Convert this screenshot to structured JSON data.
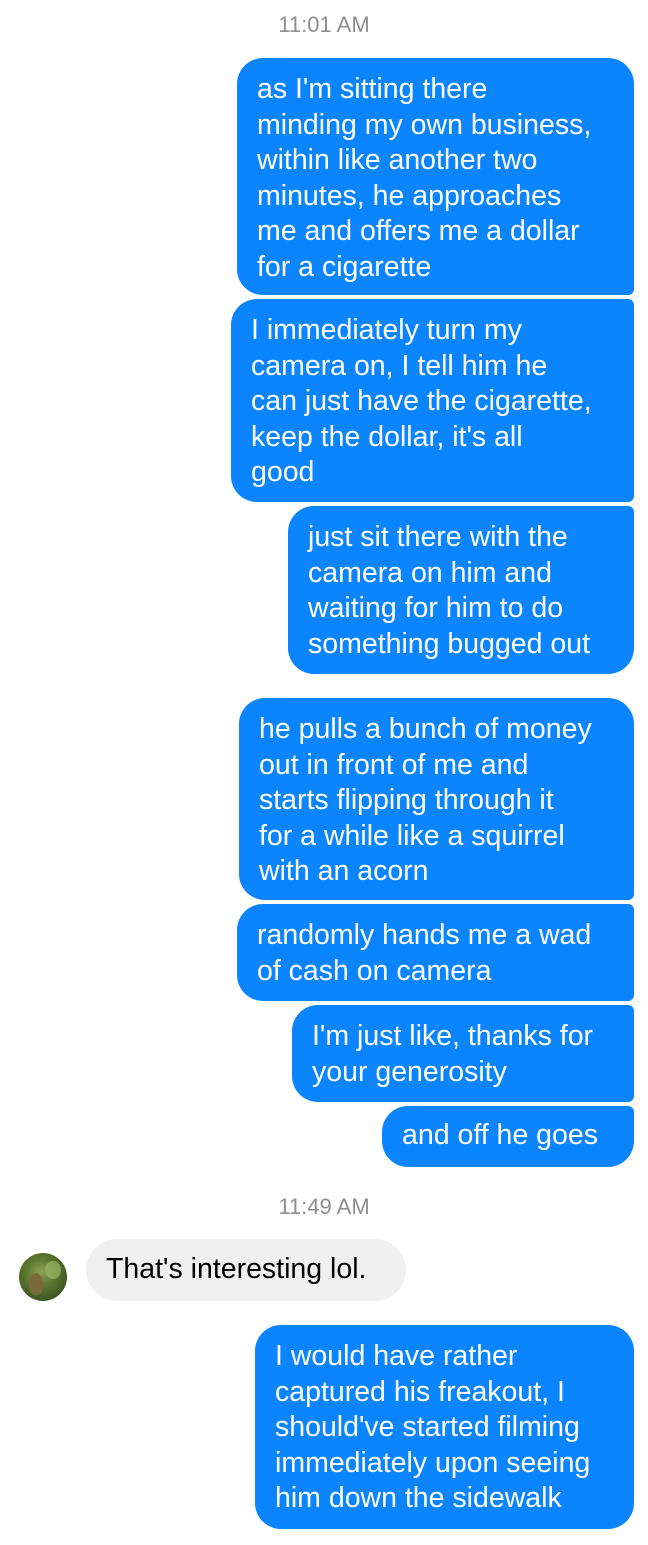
{
  "thread": {
    "timestamp_1": "11:01 AM",
    "timestamp_2": "11:49 AM",
    "messages": [
      {
        "from": "me",
        "text": "as I'm sitting there\nminding my own business,\nwithin like another two\nminutes, he approaches\nme and offers me a dollar\nfor a cigarette"
      },
      {
        "from": "me",
        "text": "I immediately turn my\ncamera on, I tell him he\ncan just have the cigarette,\nkeep the dollar, it's all\ngood"
      },
      {
        "from": "me",
        "text": "just sit there with the\ncamera on him and\nwaiting for him to do\nsomething bugged out"
      },
      {
        "from": "me",
        "text": "he pulls a bunch of money\nout in front of me and\nstarts flipping through it\nfor a while like a squirrel\nwith an acorn"
      },
      {
        "from": "me",
        "text": "randomly hands me a wad\nof cash on camera"
      },
      {
        "from": "me",
        "text": "I'm just like, thanks for\nyour generosity"
      },
      {
        "from": "me",
        "text": "and off he goes"
      },
      {
        "from": "them",
        "text": "That's interesting lol."
      },
      {
        "from": "me",
        "text": "I would have rather\ncaptured his freakout, I\nshould've started filming\nimmediately upon seeing\nhim down the sidewalk"
      }
    ]
  },
  "colors": {
    "outgoing_bubble": "#0a84ff",
    "incoming_bubble": "#f0f0f0",
    "timestamp_text": "#8e8e93"
  },
  "icons": {
    "contact_avatar": "avatar-photo"
  }
}
